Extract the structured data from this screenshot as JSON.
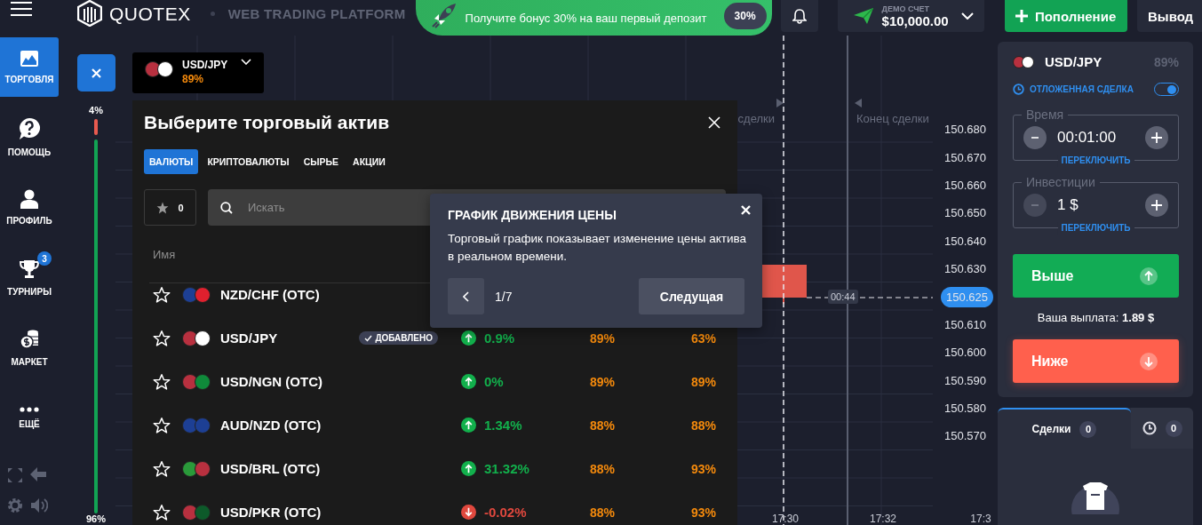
{
  "header": {
    "logo": "QUOTEX",
    "tagline": "WEB TRADING PLATFORM",
    "bonus": {
      "text": "Получите бонус 30% на ваш первый депозит",
      "badge": "30%"
    },
    "account": {
      "label": "ДЕМО СЧЕТ",
      "balance": "$10,000.00"
    },
    "deposit_button": "Пополнение",
    "withdraw_button": "Вывод"
  },
  "sidebar": {
    "items": [
      {
        "kind": "trade",
        "label": "ТОРГОВЛЯ",
        "selected": true
      },
      {
        "kind": "help",
        "label": "ПОМОЩЬ",
        "selected": false
      },
      {
        "kind": "profile",
        "label": "ПРОФИЛЬ",
        "selected": false
      },
      {
        "kind": "tournaments",
        "label": "ТУРНИРЫ",
        "badge": "3",
        "selected": false
      },
      {
        "kind": "market",
        "label": "МАРКЕТ",
        "selected": false
      },
      {
        "kind": "more",
        "label": "ЕЩЁ",
        "selected": false
      }
    ]
  },
  "sentiment": {
    "top_label": "4%",
    "bottom_label": "96%",
    "level": 0.04
  },
  "asset_chip": {
    "name": "USD/JPY",
    "payout": "89%"
  },
  "chart": {
    "start_label": "сделки",
    "end_label": "Конец сделки",
    "timer": "00:44",
    "price_axis": [
      {
        "kind": "tick",
        "label": "150.680"
      },
      {
        "kind": "tick",
        "label": "150.670"
      },
      {
        "kind": "tick",
        "label": "150.660"
      },
      {
        "kind": "tick",
        "label": "150.650"
      },
      {
        "kind": "tick",
        "label": "150.640"
      },
      {
        "kind": "tick",
        "label": "150.630"
      },
      {
        "kind": "current",
        "label": "150.625"
      },
      {
        "kind": "tick",
        "label": "150.610"
      },
      {
        "kind": "tick",
        "label": "150.600"
      },
      {
        "kind": "tick",
        "label": "150.590"
      },
      {
        "kind": "tick",
        "label": "150.580"
      },
      {
        "kind": "tick",
        "label": "150.570"
      }
    ],
    "time_labels": [
      "17:30",
      "17:32",
      "17:3"
    ]
  },
  "asset_picker": {
    "title": "Выберите торговый актив",
    "tabs": [
      {
        "label": "ВАЛЮТЫ",
        "selected": true
      },
      {
        "label": "КРИПТОВАЛЮТЫ",
        "selected": false
      },
      {
        "label": "СЫРЬЕ",
        "selected": false
      },
      {
        "label": "АКЦИИ",
        "selected": false
      }
    ],
    "favorites_count": "0",
    "search": {
      "placeholder": "Искать"
    },
    "columns": [
      "Имя"
    ],
    "rows": [
      {
        "name": "NZD/CHF (OTC)",
        "flags": [
          {
            "color": "#1d3f94"
          },
          {
            "color": "#e0202e"
          }
        ]
      },
      {
        "name": "USD/JPY",
        "flags": [
          {
            "color": "#b8303f"
          },
          {
            "color": "#ffffff"
          }
        ],
        "badge": "ДОБАВЛЕНО",
        "rising": true,
        "change": "0.9%",
        "payout": "89%",
        "column_4": "63%"
      },
      {
        "name": "USD/NGN (OTC)",
        "flags": [
          {
            "color": "#b8303f"
          },
          {
            "color": "#0f8a3a"
          }
        ],
        "rising": true,
        "change": "0%",
        "payout": "89%",
        "column_4": "89%"
      },
      {
        "name": "AUD/NZD (OTC)",
        "flags": [
          {
            "color": "#1d3f94"
          },
          {
            "color": "#1d3f94"
          }
        ],
        "rising": true,
        "change": "1.34%",
        "payout": "88%",
        "column_4": "88%"
      },
      {
        "name": "USD/BRL (OTC)",
        "flags": [
          {
            "color": "#2a9a3a"
          },
          {
            "color": "#b8303f"
          }
        ],
        "rising": true,
        "change": "31.32%",
        "payout": "88%",
        "column_4": "93%"
      },
      {
        "name": "USD/PKR (OTC)",
        "flags": [
          {
            "color": "#b8303f"
          },
          {
            "color": "#0d5a2a"
          }
        ],
        "rising": false,
        "change": "-0.02%",
        "payout": "88%",
        "column_4": "93%"
      }
    ]
  },
  "tour_tooltip": {
    "title": "ГРАФИК ДВИЖЕНИЯ ЦЕНЫ",
    "text": "Торговый график показывает изменение цены актива в реальном времени.",
    "step": "1/7",
    "next_button": "Следущая"
  },
  "trade_panel": {
    "asset": "USD/JPY",
    "payout": "89%",
    "pending": {
      "label": "ОТЛОЖЕННАЯ СДЕЛКА",
      "on": true
    },
    "fields": [
      {
        "label": "Время",
        "value": "00:01:00",
        "switch": "ПЕРЕКЛЮЧИТЬ",
        "minus_disabled": false
      },
      {
        "label": "Инвестиции",
        "value": "1 $",
        "switch": "ПЕРЕКЛЮЧИТЬ",
        "minus_disabled": true
      }
    ],
    "up_button": "Выше",
    "payout_text": "Ваша выплата: **1.89 $**",
    "down_button": "Ниже"
  },
  "trades": {
    "tabs": [
      {
        "kind": "trades",
        "label": "Сделки",
        "count": "0",
        "selected": true
      },
      {
        "kind": "pending",
        "count": "0",
        "selected": false
      }
    ]
  }
}
